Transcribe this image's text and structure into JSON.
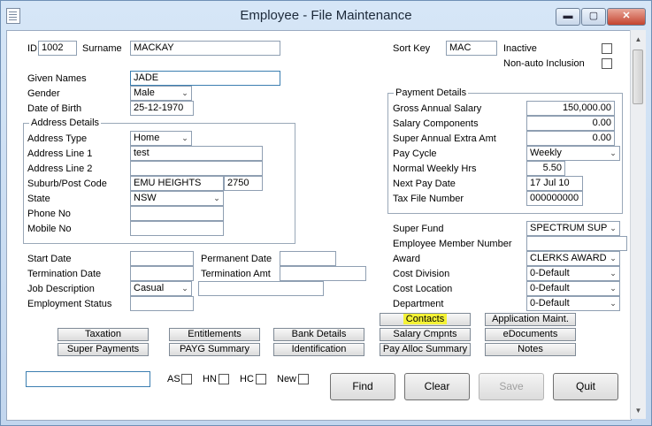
{
  "window": {
    "title": "Employee - File Maintenance"
  },
  "controls": {
    "minimize": "▬",
    "maximize": "▢",
    "close": "✕"
  },
  "scroll": {
    "up": "▲",
    "down": "▼"
  },
  "header": {
    "id_label": "ID",
    "id_value": "1002",
    "surname_label": "Surname",
    "surname_value": "MACKAY",
    "sortkey_label": "Sort Key",
    "sortkey_value": "MAC",
    "inactive_label": "Inactive",
    "nonauto_label": "Non-auto Inclusion"
  },
  "person": {
    "given_label": "Given Names",
    "given_value": "JADE",
    "gender_label": "Gender",
    "gender_value": "Male",
    "dob_label": "Date of Birth",
    "dob_value": "25-12-1970"
  },
  "address": {
    "group_title": "Address Details",
    "type_label": "Address Type",
    "type_value": "Home",
    "line1_label": "Address Line 1",
    "line1_value": "test",
    "line2_label": "Address Line 2",
    "line2_value": "",
    "suburb_label": "Suburb/Post Code",
    "suburb_value": "EMU HEIGHTS",
    "postcode_value": "2750",
    "state_label": "State",
    "state_value": "NSW",
    "phone_label": "Phone No",
    "phone_value": "",
    "mobile_label": "Mobile No",
    "mobile_value": ""
  },
  "payment": {
    "group_title": "Payment Details",
    "salary_label": "Gross Annual Salary",
    "salary_value": "150,000.00",
    "components_label": "Salary Components",
    "components_value": "0.00",
    "super_extra_label": "Super Annual Extra Amt",
    "super_extra_value": "0.00",
    "cycle_label": "Pay Cycle",
    "cycle_value": "Weekly",
    "hours_label": "Normal Weekly Hrs",
    "hours_value": "5.50",
    "next_pay_label": "Next Pay Date",
    "next_pay_value": "17 Jul 10",
    "tfn_label": "Tax File Number",
    "tfn_value": "000000000"
  },
  "employment": {
    "start_label": "Start Date",
    "start_value": "",
    "permanent_label": "Permanent Date",
    "permanent_value": "",
    "termination_label": "Termination Date",
    "termination_value": "",
    "term_amt_label": "Termination Amt",
    "term_amt_value": "",
    "job_label": "Job Description",
    "job_value": "Casual",
    "job_desc_value": "",
    "status_label": "Employment Status",
    "status_value": ""
  },
  "fund": {
    "super_label": "Super Fund",
    "super_value": "SPECTRUM SUPEI",
    "member_label": "Employee Member Number",
    "member_value": "",
    "award_label": "Award",
    "award_value": "CLERKS AWARD",
    "division_label": "Cost Division",
    "division_value": "0-Default",
    "location_label": "Cost Location",
    "location_value": "0-Default",
    "department_label": "Department",
    "department_value": "0-Default"
  },
  "buttons": {
    "contacts": "Contacts",
    "app_maint": "Application Maint.",
    "taxation": "Taxation",
    "entitlements": "Entitlements",
    "bank": "Bank Details",
    "salary_cmpnts": "Salary Cmpnts",
    "edocuments": "eDocuments",
    "super_payments": "Super Payments",
    "payg": "PAYG Summary",
    "identification": "Identification",
    "pay_alloc": "Pay Alloc Summary",
    "notes": "Notes"
  },
  "bottom": {
    "search_value": "",
    "as_label": "AS",
    "hn_label": "HN",
    "hc_label": "HC",
    "new_label": "New",
    "find": "Find",
    "clear": "Clear",
    "save": "Save",
    "quit": "Quit"
  }
}
